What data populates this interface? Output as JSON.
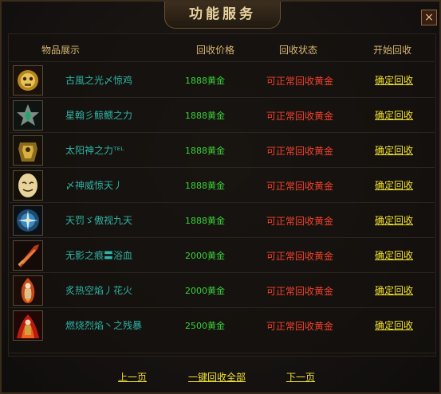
{
  "window": {
    "title": "功能服务",
    "close_label": "×"
  },
  "table": {
    "headers": {
      "item": "物品展示",
      "price": "回收价格",
      "status": "回收状态",
      "action": "开始回收"
    },
    "rows": [
      {
        "icon": "golden-skull-icon",
        "name": "古風之光〆惊鸡",
        "price": "1888黄金",
        "status": "可正常回收黄金",
        "action": "确定回收"
      },
      {
        "icon": "green-star-gem-icon",
        "name": "星翰彡鲸鳂之力",
        "price": "1888黄金",
        "status": "可正常回收黄金",
        "action": "确定回收"
      },
      {
        "icon": "golden-armor-icon",
        "name": "太阳神之力ᵀᴱᴸ",
        "price": "1888黄金",
        "status": "可正常回收黄金",
        "action": "确定回收"
      },
      {
        "icon": "mask-icon",
        "name": "〆神威惊天丿",
        "price": "1888黄金",
        "status": "可正常回收黄金",
        "action": "确定回收"
      },
      {
        "icon": "blue-compass-icon",
        "name": "天罚ゞ傲视九天",
        "price": "1888黄金",
        "status": "可正常回收黄金",
        "action": "确定回收"
      },
      {
        "icon": "red-sword-icon",
        "name": "无影之痕〓浴血",
        "price": "2000黄金",
        "status": "可正常回收黄金",
        "action": "确定回收"
      },
      {
        "icon": "flame-warrior-icon",
        "name": "炙热空焰丿花火",
        "price": "2000黄金",
        "status": "可正常回收黄金",
        "action": "确定回收"
      },
      {
        "icon": "fire-warrior-icon",
        "name": "燃烧烈焰丶之残暴",
        "price": "2500黄金",
        "status": "可正常回收黄金",
        "action": "确定回收"
      }
    ]
  },
  "footer": {
    "prev": "上一页",
    "recycle_all": "一键回收全部",
    "next": "下一页"
  }
}
